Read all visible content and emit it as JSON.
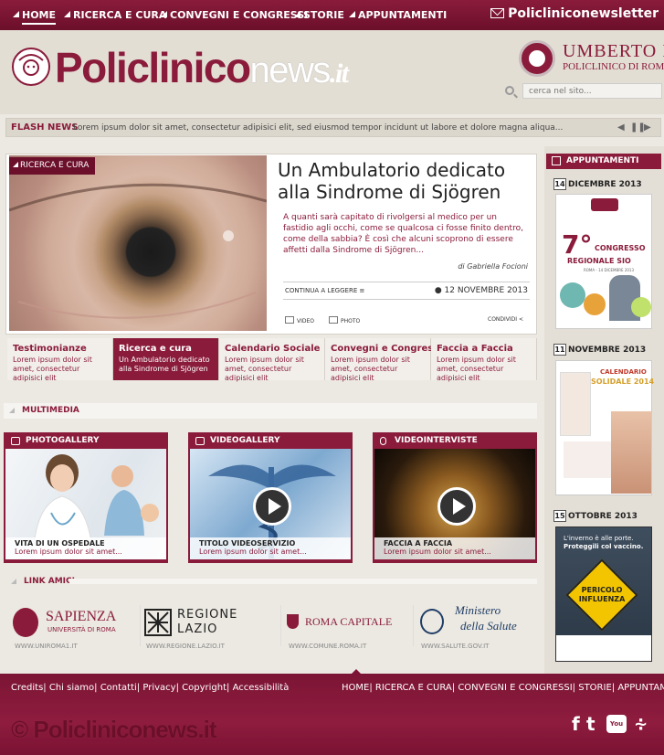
{
  "topnav": {
    "items": [
      "HOME",
      "RICERCA E CURA",
      "CONVEGNI E CONGRESSI",
      "STORIE",
      "APPUNTAMENTI"
    ],
    "newsletter": "Policliniconewsletter"
  },
  "header": {
    "logo_part1": "Policlinico",
    "logo_part2": "news",
    "logo_part3": ".it",
    "umberto_line1": "UMBERTO I",
    "umberto_line2": "POLICLINICO DI ROMA",
    "search_placeholder": "cerca nel sito..."
  },
  "flash": {
    "label": "FLASH NEWS",
    "text": "Lorem ipsum dolor sit amet, consectetur adipisici elit, sed eiusmod tempor incidunt ut labore et dolore magna aliqua..."
  },
  "hero": {
    "tag": "RICERCA E CURA",
    "title": "Un Ambulatorio dedicato alla Sindrome di Sjögren",
    "summary": "A quanti sarà capitato di rivolgersi al medico per un fastidio agli occhi, come se qualcosa ci fosse finito dentro, come della sabbia? È così che alcuni scoprono di essere affetti dalla Sindrome di Sjögren...",
    "author": "di Gabriella Focioni",
    "read_more": "CONTINUA A LEGGERE",
    "date": "12 NOVEMBRE 2013",
    "video": "VIDEO",
    "photo": "PHOTO",
    "share": "CONDIVIDI"
  },
  "tabs": [
    {
      "title": "Testimonianze",
      "desc": "Lorem ipsum dolor sit amet, consectetur adipisici elit"
    },
    {
      "title": "Ricerca e cura",
      "desc": "Un Ambulatorio dedicato alla Sindrome di Sjögren"
    },
    {
      "title": "Calendario Sociale",
      "desc": "Lorem ipsum dolor sit amet, consectetur adipisici elit"
    },
    {
      "title": "Convegni e Congressi",
      "desc": "Lorem ipsum dolor sit amet, consectetur adipisici elit"
    },
    {
      "title": "Faccia a Faccia",
      "desc": "Lorem ipsum dolor sit amet, consectetur adipisici elit"
    }
  ],
  "multimedia": {
    "heading": "MULTIMEDIA",
    "cards": [
      {
        "header": "PHOTOGALLERY",
        "title": "VITA DI UN OSPEDALE",
        "desc": "Lorem ipsum dolor sit amet..."
      },
      {
        "header": "VIDEOGALLERY",
        "title": "TITOLO VIDEOSERVIZIO",
        "desc": "Lorem ipsum dolor sit amet..."
      },
      {
        "header": "VIDEOINTERVISTE",
        "title": "FACCIA A FACCIA",
        "desc": "Lorem ipsum dolor sit amet..."
      }
    ]
  },
  "links": {
    "heading": "LINK AMICI",
    "partners": [
      {
        "name": "SAPIENZA",
        "sub": "UNIVERSITÀ DI ROMA",
        "url": "WWW.UNIROMA1.IT"
      },
      {
        "name": "REGIONE",
        "sub": "LAZIO",
        "url": "WWW.REGIONE.LAZIO.IT"
      },
      {
        "name": "ROMA CAPITALE",
        "sub": "",
        "url": "WWW.COMUNE.ROMA.IT"
      },
      {
        "name": "Ministero",
        "sub": "della Salute",
        "url": "WWW.SALUTE.GOV.IT"
      }
    ]
  },
  "sidebar": {
    "heading": "APPUNTAMENTI",
    "events": [
      {
        "day": "14",
        "month": "DICEMBRE 2013",
        "poster_big": "7°",
        "poster_line1": "CONGRESSO",
        "poster_line2": "REGIONALE SIO",
        "poster_sub": "ROMA - 14 DICEMBRE 2013"
      },
      {
        "day": "11",
        "month": "NOVEMBRE 2013",
        "poster_big": "CALENDARIO",
        "poster_line1": "SOLIDALE 2014",
        "poster_line2": "",
        "poster_sub": ""
      },
      {
        "day": "15",
        "month": "OTTOBRE 2013",
        "poster_big": "L'inverno è alle porte.",
        "poster_line1": "Proteggili col vaccino.",
        "poster_line2": "PERICOLO INFLUENZA",
        "poster_sub": ""
      }
    ]
  },
  "footer": {
    "left_links": [
      "Credits",
      "Chi siamo",
      "Contatti",
      "Privacy",
      "Copyright",
      "Accessibilità"
    ],
    "right_links": [
      "HOME",
      "RICERCA E CURA",
      "CONVEGNI E CONGRESSI",
      "STORIE",
      "APPUNTAMENTI"
    ],
    "logo": "© Policliniconews.it",
    "social": [
      "facebook-icon",
      "twitter-icon",
      "youtube-icon",
      "rss-icon"
    ]
  },
  "colors": {
    "brand": "#8a1b3b",
    "background": "#ece9e2"
  }
}
